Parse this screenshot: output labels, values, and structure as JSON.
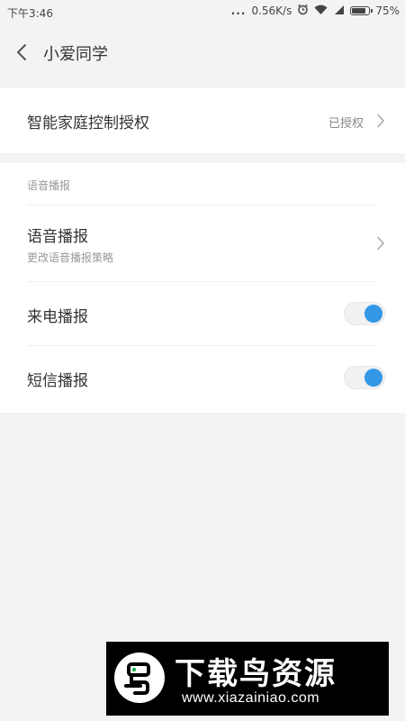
{
  "status_bar": {
    "time": "下午3:46",
    "dots": "...",
    "network_speed": "0.56K/s",
    "battery_percent": "75%",
    "battery_level": 0.75,
    "icons": [
      "alarm-icon",
      "wifi-icon",
      "signal-icon",
      "battery-icon"
    ]
  },
  "header": {
    "title": "小爱同学",
    "back_icon": "chevron-left-icon"
  },
  "auth_card": {
    "title": "智能家庭控制授权",
    "value": "已授权"
  },
  "voice_section": {
    "label": "语音播报",
    "items": [
      {
        "title": "语音播报",
        "subtitle": "更改语音播报策略",
        "type": "link"
      },
      {
        "title": "来电播报",
        "type": "toggle",
        "on": true
      },
      {
        "title": "短信播报",
        "type": "toggle",
        "on": true
      }
    ]
  },
  "watermark": {
    "title": "下载鸟资源",
    "url": "www.xiazainiao.com"
  },
  "colors": {
    "background": "#f3f3f3",
    "card": "#ffffff",
    "accent": "#3399e6",
    "text": "#333333",
    "muted": "#999999"
  }
}
